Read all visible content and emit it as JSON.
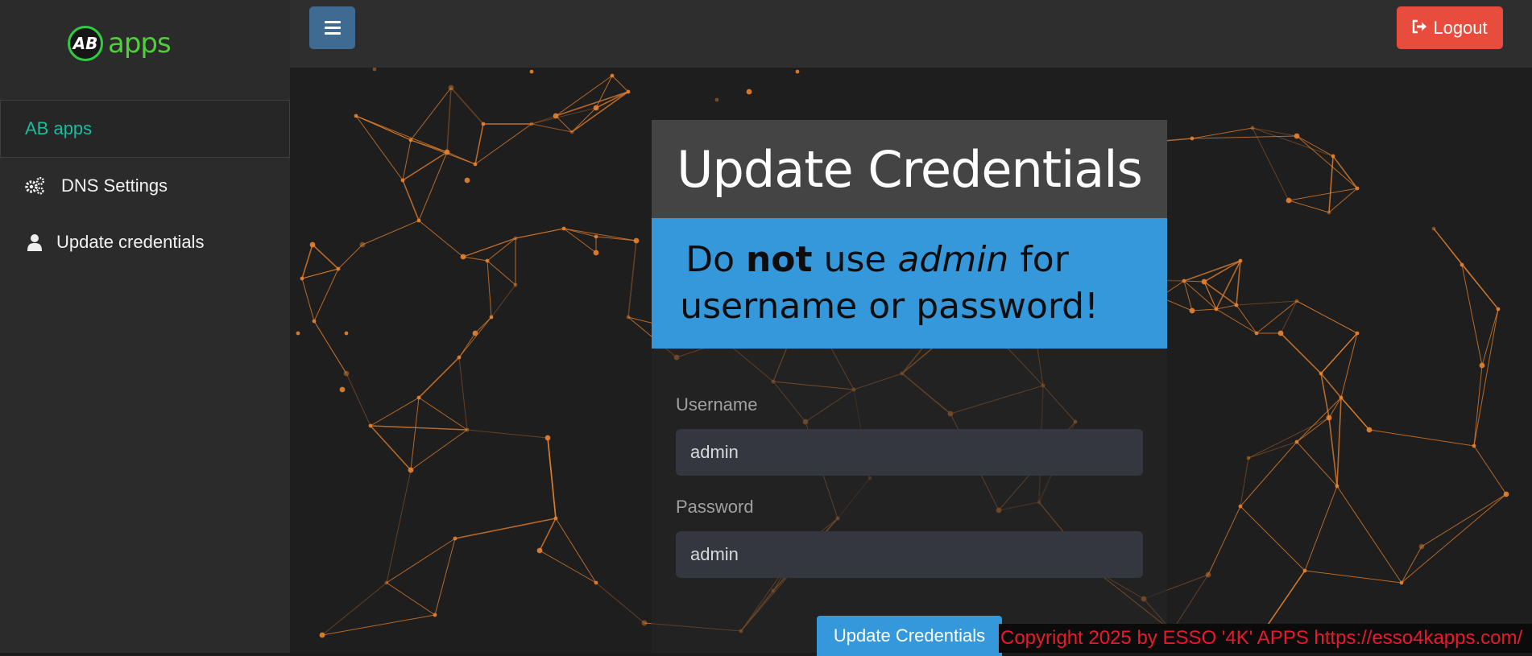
{
  "sidebar": {
    "logo": {
      "badge": "AB",
      "text": "apps"
    },
    "active_item": "AB apps",
    "items": [
      {
        "label": "DNS Settings",
        "icon": "gears-icon"
      },
      {
        "label": "Update credentials",
        "icon": "user-icon"
      }
    ]
  },
  "topbar": {
    "logout_label": "Logout"
  },
  "card": {
    "title": "Update Credentials",
    "warning": {
      "pre": "Do ",
      "bold": "not",
      "mid": " use ",
      "italic": "admin",
      "post": " for",
      "line2": "username or password!"
    },
    "username_label": "Username",
    "username_value": "admin",
    "password_label": "Password",
    "password_value": "admin",
    "submit_label": "Update Credentials"
  },
  "footer": {
    "text": "Copyright 2025  by ESSO '4K' APPS https://esso4kapps.com/"
  },
  "colors": {
    "accent_blue": "#3498db",
    "logout_red": "#e74c3c",
    "active_teal": "#1abc9c",
    "logo_green": "#4cd137",
    "network_orange": "#e8822e"
  }
}
